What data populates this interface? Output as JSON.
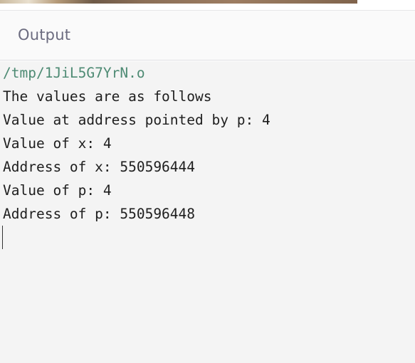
{
  "output_panel": {
    "title": "Output"
  },
  "console": {
    "path": "/tmp/1JiL5G7YrN.o",
    "lines": [
      "The values are as follows",
      "Value at address pointed by p: 4",
      "Value of x: 4",
      "Address of x: 550596444",
      "Value of p: 4",
      "Address of p: 550596448"
    ]
  }
}
